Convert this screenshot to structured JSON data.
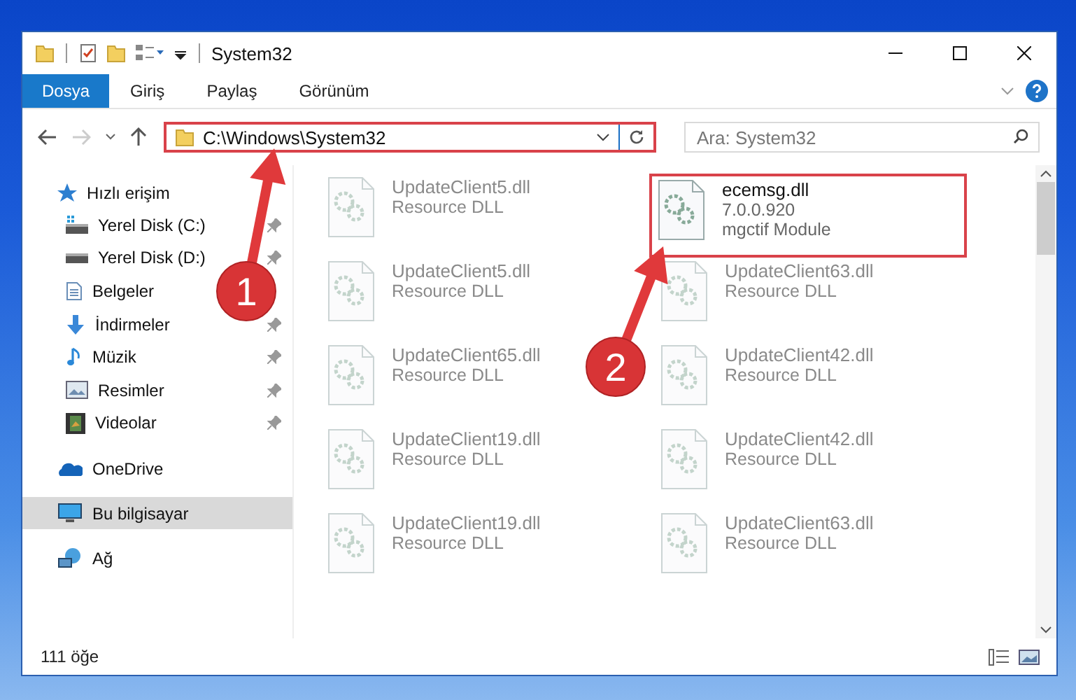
{
  "window": {
    "title": "System32"
  },
  "ribbon_tabs": [
    {
      "label": "Dosya",
      "selected": true
    },
    {
      "label": "Giriş",
      "selected": false
    },
    {
      "label": "Paylaş",
      "selected": false
    },
    {
      "label": "Görünüm",
      "selected": false
    }
  ],
  "address": {
    "path": "C:\\Windows\\System32",
    "highlighted": true
  },
  "search": {
    "placeholder": "Ara: System32"
  },
  "sidebar": {
    "items": [
      {
        "label": "Hızlı erişim",
        "kind": "star",
        "selected": false,
        "children": [
          {
            "label": "Yerel Disk (C:)",
            "kind": "drive-c",
            "pinned": true
          },
          {
            "label": "Yerel Disk (D:)",
            "kind": "drive",
            "pinned": true
          },
          {
            "label": "Belgeler",
            "kind": "document"
          },
          {
            "label": "İndirmeler",
            "kind": "download",
            "pinned": true
          },
          {
            "label": "Müzik",
            "kind": "music",
            "pinned": true
          },
          {
            "label": "Resimler",
            "kind": "pictures",
            "pinned": true
          },
          {
            "label": "Videolar",
            "kind": "videos",
            "pinned": true
          }
        ]
      },
      {
        "label": "OneDrive",
        "kind": "cloud",
        "selected": false
      },
      {
        "label": "Bu bilgisayar",
        "kind": "computer",
        "selected": true
      },
      {
        "label": "Ağ",
        "kind": "network",
        "selected": false
      }
    ]
  },
  "files": [
    {
      "name": "UpdateClient5.dll",
      "details": [
        "Resource DLL"
      ],
      "blurred": true,
      "highlighted": false
    },
    {
      "name": "ecemsg.dll",
      "details": [
        "7.0.0.920",
        "mgctif Module"
      ],
      "blurred": false,
      "highlighted": true
    },
    {
      "name": "UpdateClient5.dll",
      "details": [
        "Resource DLL"
      ],
      "blurred": true,
      "highlighted": false
    },
    {
      "name": "UpdateClient63.dll",
      "details": [
        "Resource DLL"
      ],
      "blurred": true,
      "highlighted": false
    },
    {
      "name": "UpdateClient65.dll",
      "details": [
        "Resource DLL"
      ],
      "blurred": true,
      "highlighted": false
    },
    {
      "name": "UpdateClient42.dll",
      "details": [
        "Resource DLL"
      ],
      "blurred": true,
      "highlighted": false
    },
    {
      "name": "UpdateClient19.dll",
      "details": [
        "Resource DLL"
      ],
      "blurred": true,
      "highlighted": false
    },
    {
      "name": "UpdateClient42.dll",
      "details": [
        "Resource DLL"
      ],
      "blurred": true,
      "highlighted": false
    },
    {
      "name": "UpdateClient19.dll",
      "details": [
        "Resource DLL"
      ],
      "blurred": true,
      "highlighted": false
    },
    {
      "name": "UpdateClient63.dll",
      "details": [
        "Resource DLL"
      ],
      "blurred": true,
      "highlighted": false
    }
  ],
  "status_bar": {
    "item_count": "111 öğe"
  },
  "annotations": [
    {
      "label": "1"
    },
    {
      "label": "2"
    }
  ]
}
